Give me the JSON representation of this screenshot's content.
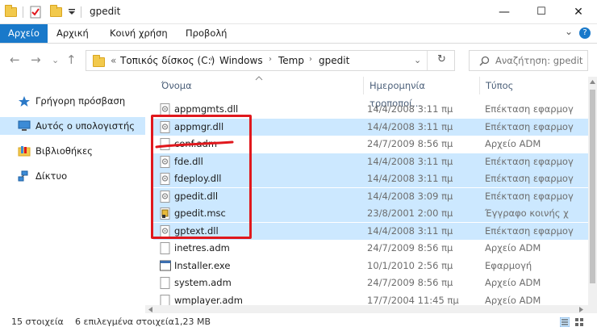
{
  "window": {
    "title": "gpedit",
    "controls": {
      "minimize": "—",
      "maximize": "☐",
      "close": "✕"
    }
  },
  "ribbon": {
    "tabs": [
      {
        "label": "Αρχείο"
      },
      {
        "label": "Αρχική"
      },
      {
        "label": "Κοινή χρήση"
      },
      {
        "label": "Προβολή"
      }
    ],
    "expand": "⌄",
    "help": "?"
  },
  "address": {
    "overflow": "«",
    "crumbs": [
      "Τοπικός δίσκος (C:)",
      "Windows",
      "Temp",
      "gpedit"
    ],
    "separator": "›",
    "dropdown": "⌄",
    "refresh": "↻"
  },
  "search": {
    "placeholder": "Αναζήτηση: gpedit"
  },
  "nav_buttons": {
    "back": "←",
    "forward": "→",
    "recent": "⌄",
    "up": "↑"
  },
  "navpane": {
    "items": [
      {
        "label": "Γρήγορη πρόσβαση",
        "icon": "star-icon"
      },
      {
        "label": "Αυτός ο υπολογιστής",
        "icon": "computer-icon"
      },
      {
        "label": "Βιβλιοθήκες",
        "icon": "library-icon"
      },
      {
        "label": "Δίκτυο",
        "icon": "network-icon"
      }
    ]
  },
  "columns": {
    "name": "Όνομα",
    "date": "Ημερομηνία τροποποί...",
    "type": "Τύπος",
    "sort_indicator": "^"
  },
  "files": [
    {
      "name": "appmgmts.dll",
      "date": "14/4/2008 3:11 πμ",
      "type": "Επέκταση εφαρμογ",
      "selected": false,
      "icon": "dll-icon"
    },
    {
      "name": "appmgr.dll",
      "date": "14/4/2008 3:11 πμ",
      "type": "Επέκταση εφαρμογ",
      "selected": true,
      "icon": "dll-icon"
    },
    {
      "name": "conf.adm",
      "date": "24/7/2009 8:56 πμ",
      "type": "Αρχείο ADM",
      "selected": false,
      "icon": "file-icon"
    },
    {
      "name": "fde.dll",
      "date": "14/4/2008 3:11 πμ",
      "type": "Επέκταση εφαρμογ",
      "selected": true,
      "icon": "dll-icon"
    },
    {
      "name": "fdeploy.dll",
      "date": "14/4/2008 3:11 πμ",
      "type": "Επέκταση εφαρμογ",
      "selected": true,
      "icon": "dll-icon"
    },
    {
      "name": "gpedit.dll",
      "date": "14/4/2008 3:09 πμ",
      "type": "Επέκταση εφαρμογ",
      "selected": true,
      "icon": "dll-icon"
    },
    {
      "name": "gpedit.msc",
      "date": "23/8/2001 2:00 πμ",
      "type": "Έγγραφο κοινής χ",
      "selected": true,
      "icon": "msc-icon"
    },
    {
      "name": "gptext.dll",
      "date": "14/4/2008 3:11 πμ",
      "type": "Επέκταση εφαρμογ",
      "selected": true,
      "icon": "dll-icon"
    },
    {
      "name": "inetres.adm",
      "date": "24/7/2009 8:56 πμ",
      "type": "Αρχείο ADM",
      "selected": false,
      "icon": "file-icon"
    },
    {
      "name": "Installer.exe",
      "date": "10/1/2010 2:56 πμ",
      "type": "Εφαρμογή",
      "selected": false,
      "icon": "exe-icon"
    },
    {
      "name": "system.adm",
      "date": "24/7/2009 8:56 πμ",
      "type": "Αρχείο ADM",
      "selected": false,
      "icon": "file-icon"
    },
    {
      "name": "wmplayer.adm",
      "date": "17/7/2004 11:45 πμ",
      "type": "Αρχείο ADM",
      "selected": false,
      "icon": "file-icon"
    }
  ],
  "status": {
    "count": "15 στοιχεία",
    "selected": "6 επιλεγμένα στοιχεία",
    "size": "1,23 MB"
  },
  "colors": {
    "accent": "#1979ca",
    "selection": "#cce8ff",
    "annotation": "#e0181d"
  }
}
